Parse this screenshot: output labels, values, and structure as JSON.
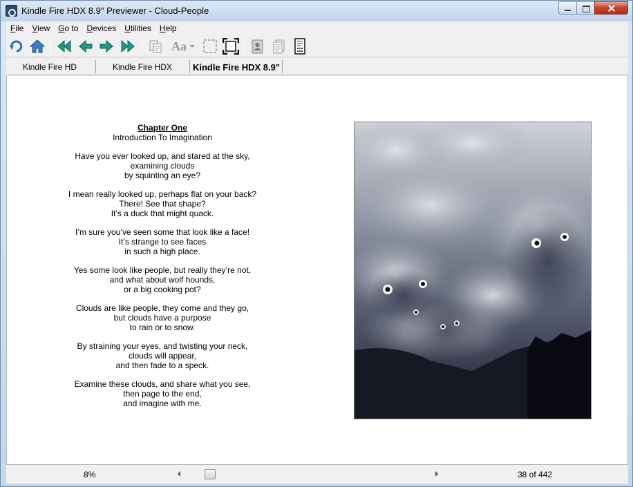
{
  "window": {
    "title": "Kindle Fire HDX 8.9\" Previewer - Cloud-People"
  },
  "menu": {
    "items": [
      {
        "accel": "F",
        "rest": "ile"
      },
      {
        "accel": "V",
        "rest": "iew"
      },
      {
        "accel": "G",
        "rest": "o to"
      },
      {
        "accel": "D",
        "rest": "evices"
      },
      {
        "accel": "U",
        "rest": "tilities"
      },
      {
        "accel": "H",
        "rest": "elp"
      }
    ]
  },
  "toolbar": {
    "icons": [
      "back-icon",
      "home-icon",
      "first-page-icon",
      "previous-page-icon",
      "next-page-icon",
      "last-page-icon",
      "copy-icon",
      "font-size-icon",
      "fit-screen-icon",
      "full-screen-icon",
      "book-cover-icon",
      "page-icon",
      "device-info-icon"
    ],
    "font_label": "Aa"
  },
  "tabs": {
    "items": [
      "Kindle Fire HD",
      "Kindle Fire HDX",
      "Kindle Fire HDX 8.9\""
    ],
    "active_index": 2
  },
  "book": {
    "chapter_title": "Chapter One",
    "subtitle": "Introduction To Imagination",
    "stanzas": [
      [
        "Have you ever looked up, and stared at the sky,",
        "examining clouds",
        "by squinting an eye?"
      ],
      [
        "I mean really looked up, perhaps flat on your back?",
        "There! See that shape?",
        "It’s a duck that might quack."
      ],
      [
        "I’m sure you’ve seen some that look like a face!",
        "It’s strange to see faces",
        "in such a high place."
      ],
      [
        "Yes some look like people, but really they’re not,",
        "and what about wolf hounds,",
        "or a big cooking pot?"
      ],
      [
        "Clouds are like people, they come and they go,",
        "but clouds have a purpose",
        "to rain or to snow."
      ],
      [
        "By straining your eyes, and twisting your neck,",
        "clouds will appear,",
        "and then fade to a speck."
      ],
      [
        "Examine these clouds, and share what you see,",
        "then page to the end,",
        "and imagine with me."
      ]
    ]
  },
  "status": {
    "progress": "8%",
    "scroll_position": 0.08,
    "page_count": "38 of 442"
  }
}
